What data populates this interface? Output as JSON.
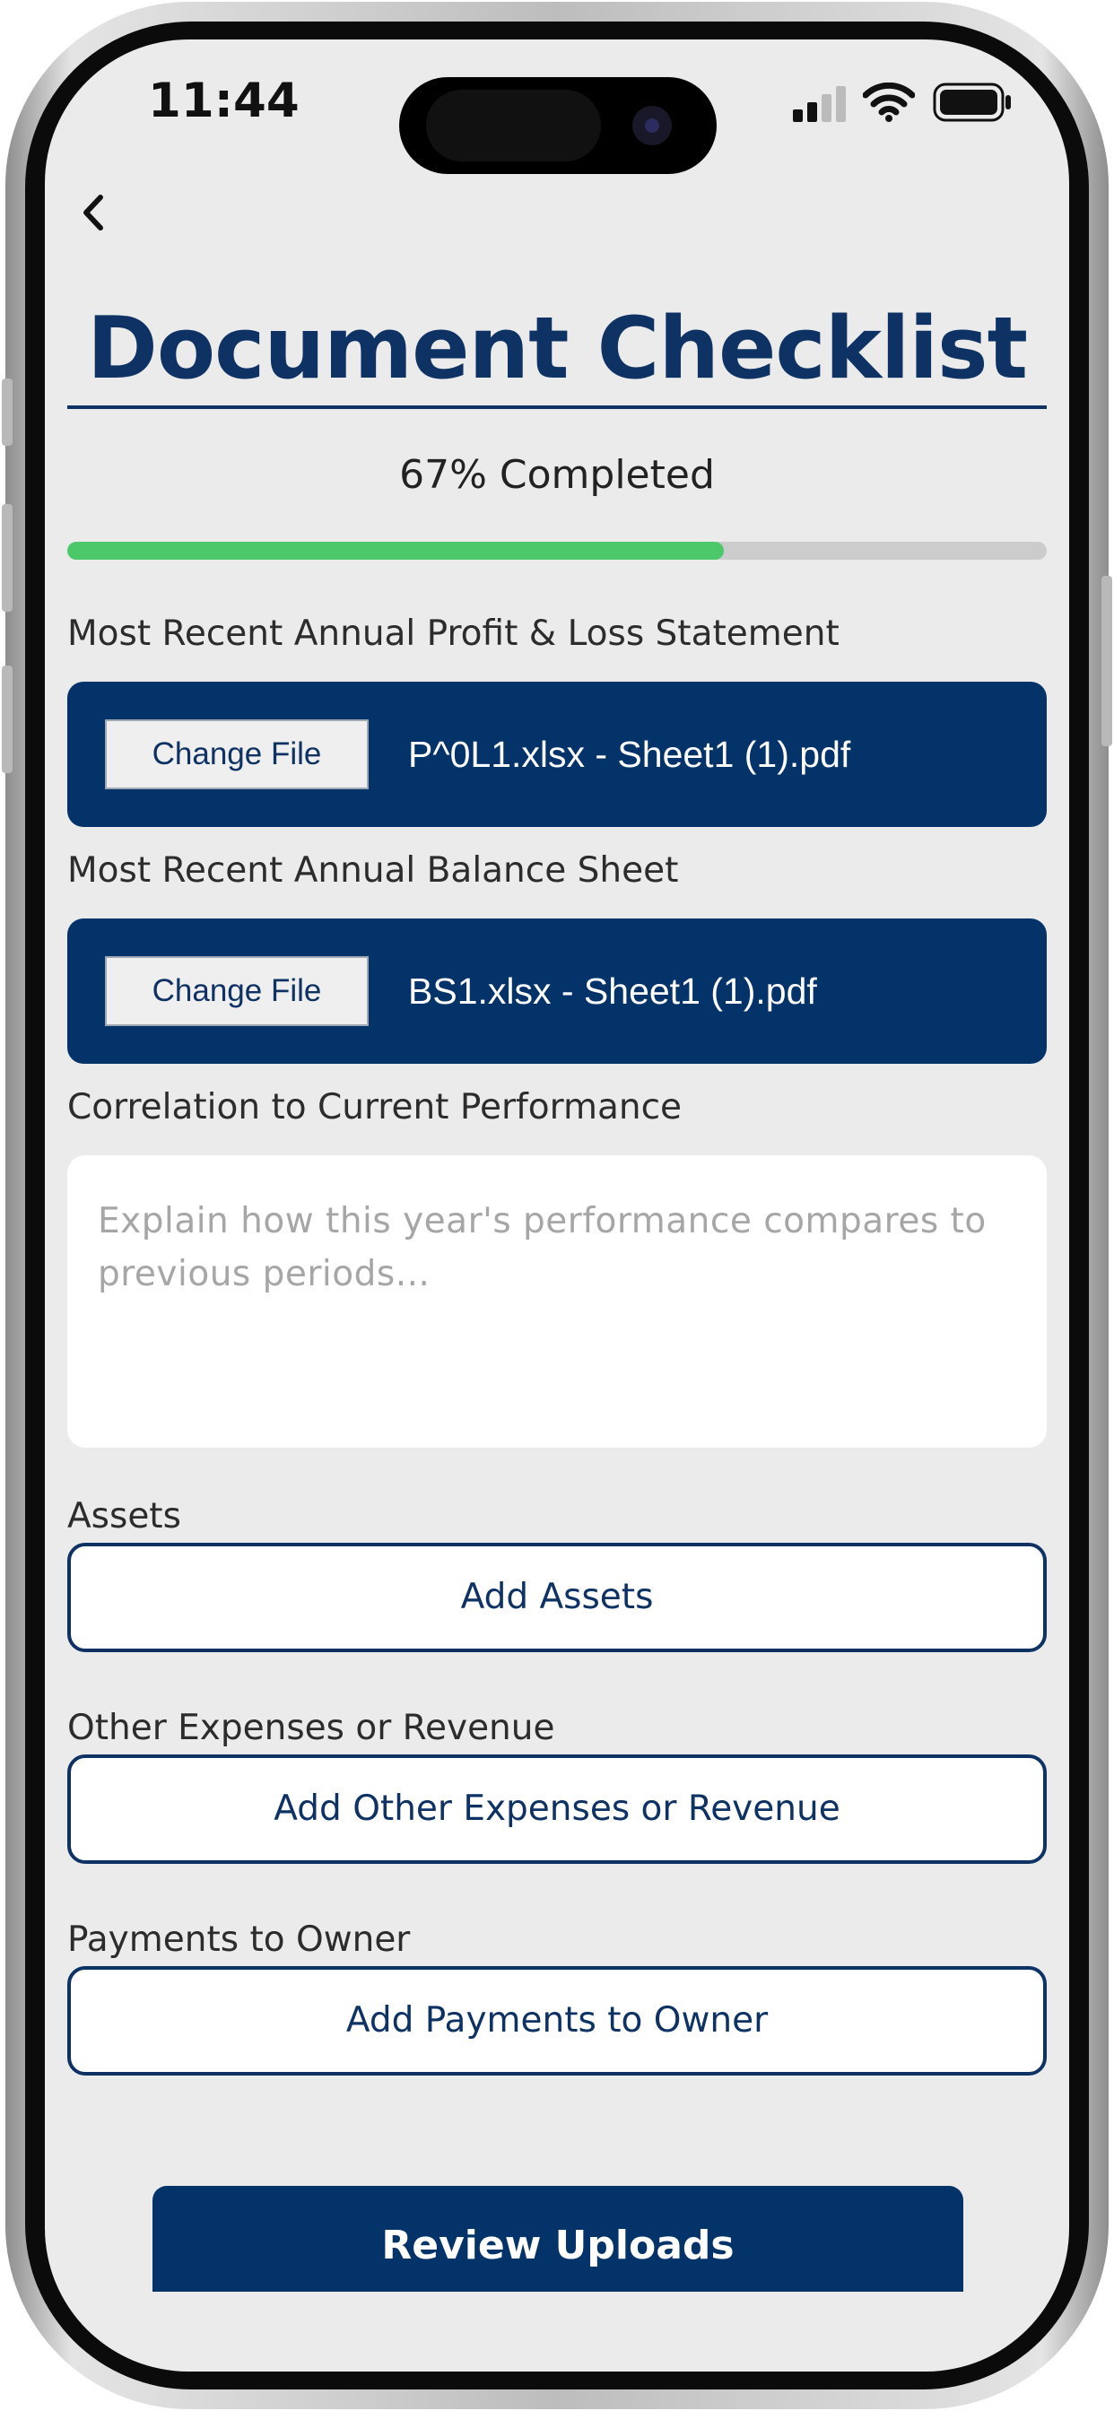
{
  "status_bar": {
    "time": "11:44"
  },
  "header": {
    "title": "Document Checklist"
  },
  "progress": {
    "percent": 67,
    "label": "67% Completed"
  },
  "documents": [
    {
      "label": "Most Recent Annual Profit & Loss Statement",
      "button": "Change File",
      "filename": "P^0L1.xlsx - Sheet1 (1).pdf"
    },
    {
      "label": "Most Recent Annual Balance Sheet",
      "button": "Change File",
      "filename": "BS1.xlsx - Sheet1 (1).pdf"
    }
  ],
  "correlation": {
    "label": "Correlation to Current Performance",
    "placeholder": "Explain how this year's performance compares to previous periods..."
  },
  "sections": [
    {
      "label": "Assets",
      "button": "Add Assets"
    },
    {
      "label": "Other Expenses or Revenue",
      "button": "Add Other Expenses or Revenue"
    },
    {
      "label": "Payments to Owner",
      "button": "Add Payments to Owner"
    }
  ],
  "footer": {
    "review_label": "Review Uploads"
  },
  "colors": {
    "brand": "#04336a",
    "progress": "#4cc76a",
    "background": "#ebebeb"
  },
  "icons": [
    "back-chevron-icon",
    "signal-icon",
    "wifi-icon",
    "battery-icon"
  ]
}
